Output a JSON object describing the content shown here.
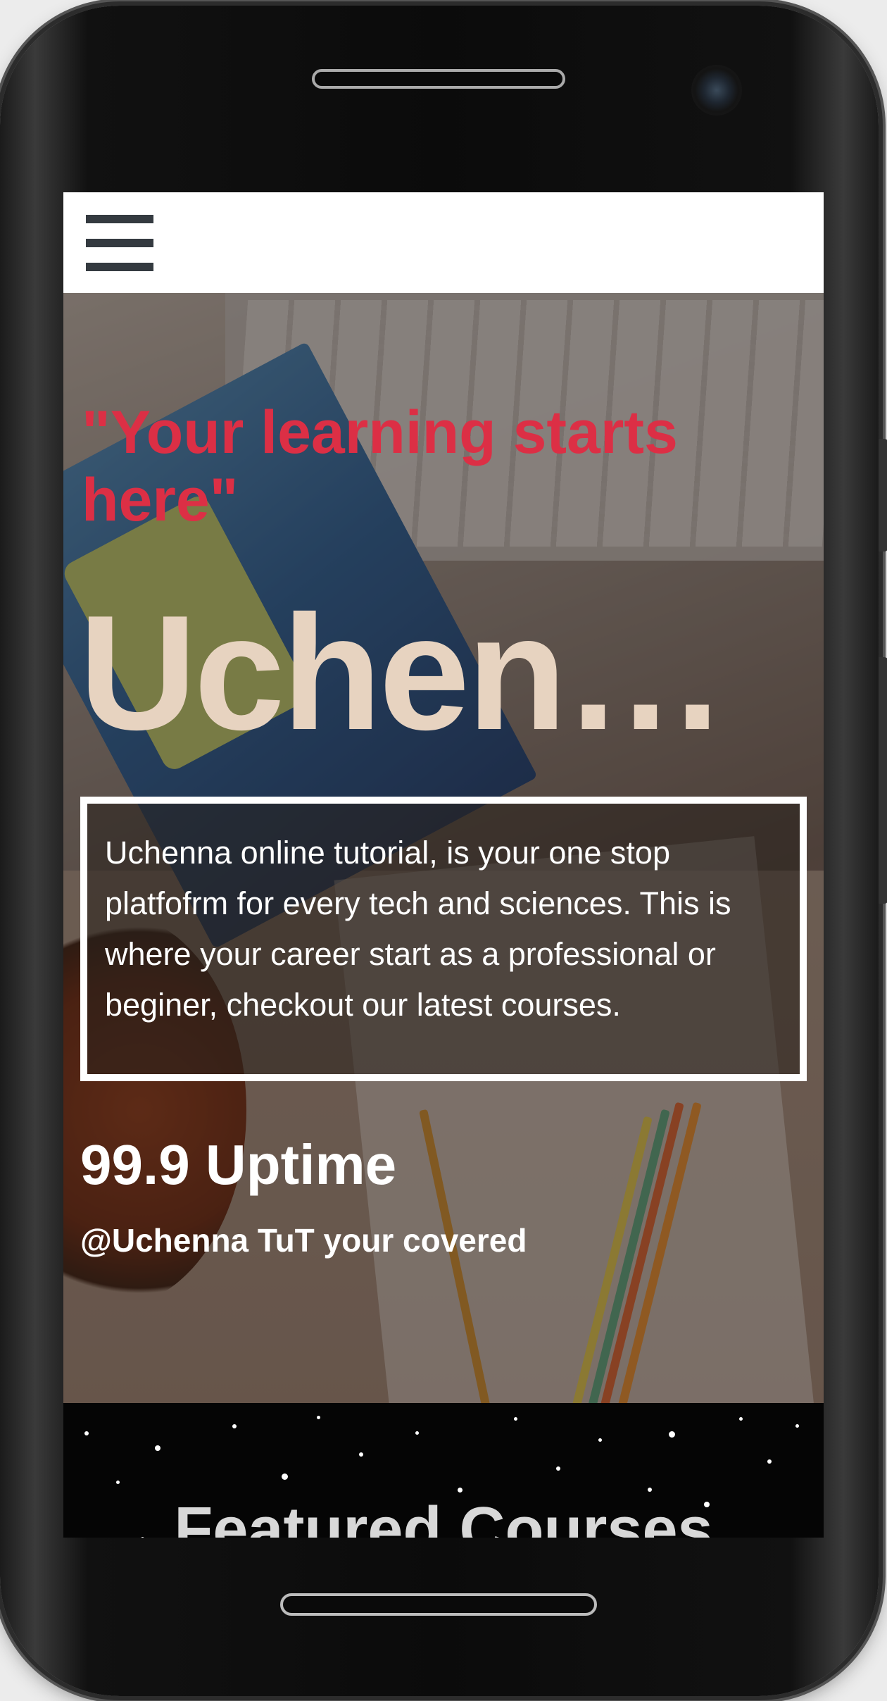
{
  "nav": {
    "menu_icon": "hamburger-menu-icon"
  },
  "hero": {
    "tagline": "\"Your learning starts here\"",
    "brand": "Uchenna Online Tutorial",
    "about": "Uchenna online tutorial, is your one stop platfofrm for every tech and sciences. This is where your career start as a professional or beginer, checkout our latest courses.",
    "uptime": "99.9 Uptime",
    "covered": "@Uchenna TuT your covered"
  },
  "featured": {
    "title": "Featured Courses"
  },
  "colors": {
    "tagline": "#dc2f45",
    "brand": "#e7d3c0",
    "topbar": "#ffffff",
    "menu_icon": "#343a40",
    "featured_bg": "#050505"
  }
}
